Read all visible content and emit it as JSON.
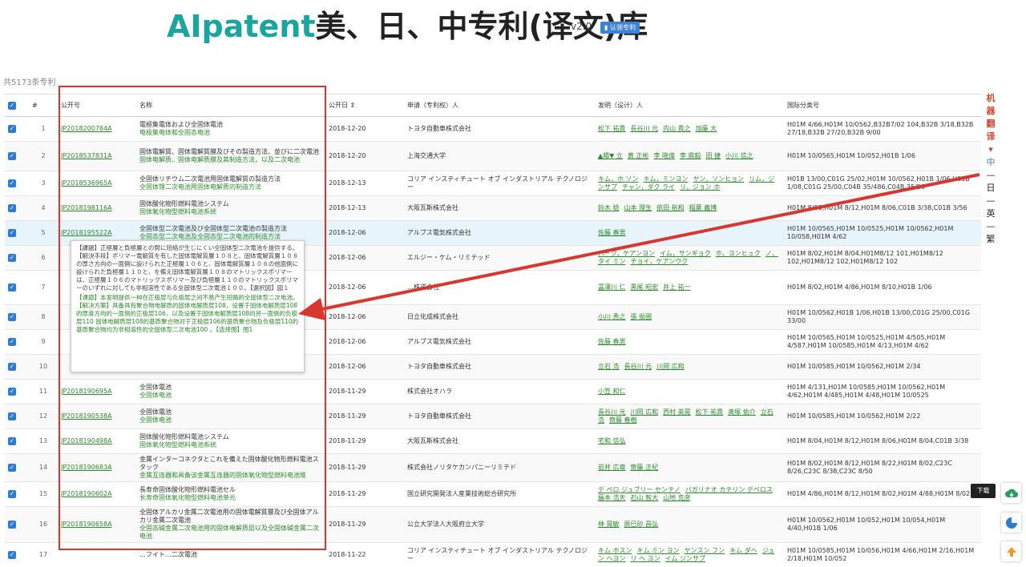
{
  "header": {
    "brand_ai": "AIpatent",
    "brand_rest": "美、日、中专利(译文)库",
    "version": "v2.0",
    "claim_button": "认领专利"
  },
  "total_label": "共5173条专利",
  "columns": [
    "#",
    "公开号",
    "名称",
    "公开日",
    "申请（专利权）人",
    "发明（设计）人",
    "国际分类号"
  ],
  "sort_icon": "sort-icon",
  "rows": [
    {
      "n": "1",
      "pub": "JP2018200784A",
      "title": "電極集電体および全固体電池",
      "title_tr": "电极集电体和全固态电池",
      "date": "2018-12-20",
      "app": "トヨタ自動車株式会社",
      "inv": [
        "松下 祐貴",
        "長谷川 元",
        "内山 貴之",
        "加藤 大"
      ],
      "ipc": "H01M 4/66,H01M 10/0562,B32B7/02 104,B32B 3/18,B32B 27/18,B32B 27/20,B32B 9/00"
    },
    {
      "n": "2",
      "pub": "JP2018537831A",
      "title": "固体電解質、固体電解質膜及びその製造方法、並びに二次電池",
      "title_tr": "固体电解质、固体电解质膜及其制造方法，以及二次电池",
      "date": "2018-12-20",
      "app": "上海交通大学",
      "inv": [
        "▲楊▼ 立",
        "黄 正彬",
        "李 晓偉",
        "李 鼎毅",
        "田 捷",
        "小川 信之"
      ],
      "ipc": "H01M 10/0565,H01M 10/052,H01B 1/06"
    },
    {
      "n": "3",
      "pub": "JP2018536965A",
      "title": "全固体リチウム二次電池用固体電解質の製造方法",
      "title_tr": "全固体锂二次电池用固体电解质的制造方法",
      "date": "2018-12-13",
      "app": "コリア インスティチュート オブ インダストリアル テクノロジー",
      "inv": [
        "キム，ホ ソン",
        "キム，ミンヨン",
        "ヤン，ソンヒョン",
        "リム，ジンサプ",
        "チャン，ダク ライ",
        "リ，ジョン ホ"
      ],
      "ipc": "H01B 13/00,C01G 25/02,H01M 10/0562,H01B 1/06,H01B 1/08,C01G 25/00,C04B 35/486,C04B 35/50"
    },
    {
      "n": "4",
      "pub": "JP2018198116A",
      "title": "固体酸化物形燃料電池システム",
      "title_tr": "固体氧化物型燃料电池系统",
      "date": "2018-12-13",
      "app": "大阪瓦斯株式会社",
      "inv": [
        "鈴木 稔",
        "山本 理生",
        "依田 裕和",
        "稲葉 義博"
      ],
      "ipc": "H01M 8/06,H01M 8/12,H01M 8/06,C01B 3/38,C01B 3/56"
    },
    {
      "n": "5",
      "pub": "JP2018195522A",
      "title": "全固体型二次電池及び全固体型二次電池の製造方法",
      "title_tr": "全固态型二次电池及全固态型二次电池的制造方法",
      "date": "2018-12-06",
      "app": "アルプス電気株式会社",
      "inv": [
        "佐藤 春男"
      ],
      "ipc": "H01M 10/0565,H01M 10/0525,H01M 10/0562,H01M 10/058,H01M 4/62"
    },
    {
      "n": "6",
      "pub": "",
      "title": "",
      "title_tr": "",
      "date": "2018-12-06",
      "app": "エルジー・ケム・リミテッド",
      "inv": [
        "パーク，ケアンヨン",
        "イム，サンギョク",
        "ホ，ヨンヒュク",
        "ノ，タイ ミン",
        "チョイ，ケアンウク"
      ],
      "ipc": "H01M 8/02,H01M 8/04,H01M8/12 101,H01M8/12 102,H01M8/12 102,H01M8/12 102"
    },
    {
      "n": "7",
      "pub": "",
      "title": "",
      "title_tr": "",
      "date": "2018-12-06",
      "app": "…株式会社",
      "inv": [
        "冨澤川 仁",
        "黒尾 昭宏",
        "井上 祐一"
      ],
      "ipc": "H01M 8/02,H01M 4/86,H01M 8/10,H01B 1/06"
    },
    {
      "n": "8",
      "pub": "",
      "title": "",
      "title_tr": "",
      "date": "2018-12-06",
      "app": "日立化成株式会社",
      "inv": [
        "小川 秀之",
        "張 振國"
      ],
      "ipc": "H01M 10/0562,H01B 1/06,H01B 13/00,C01G 25/00,C01G 33/00"
    },
    {
      "n": "9",
      "pub": "",
      "title": "",
      "title_tr": "",
      "date": "2018-12-06",
      "app": "アルプス電気株式会社",
      "inv": [
        "佐藤 春男"
      ],
      "ipc": "H01M 10/0565,H01M 10/0525,H01M 4/505,H01M 4/587,H01M 10/0585,H01M 4/13,H01M 4/62"
    },
    {
      "n": "10",
      "pub": "",
      "title": "",
      "title_tr": "",
      "date": "2018-12-06",
      "app": "トヨタ自動車株式会社",
      "inv": [
        "立石 浩",
        "長谷川 元",
        "川岡 広和"
      ],
      "ipc": "H01M 10/0585,H01M 10/0562,H01M 2/34"
    },
    {
      "n": "11",
      "pub": "JP2018190695A",
      "title": "全固体電池",
      "title_tr": "全固体电池",
      "date": "2018-11-29",
      "app": "株式会社オハラ",
      "inv": [
        "小笠 和仁"
      ],
      "ipc": "H01M 4/131,H01M 10/0585,H01M 10/0562,H01M 4/62,H01M 4/485,H01M 4/48,H01M 10/0525"
    },
    {
      "n": "12",
      "pub": "JP2018190538A",
      "title": "全固体電池",
      "title_tr": "全固体电池",
      "date": "2018-11-29",
      "app": "トヨタ自動車株式会社",
      "inv": [
        "長谷川 元",
        "川岡 広和",
        "西村 英晃",
        "松下 祐貴",
        "奥塚 佑介",
        "立石 浩",
        "齋藤 春樹"
      ],
      "ipc": "H01M 10/0585,H01M 10/0562,H01M 2/22"
    },
    {
      "n": "13",
      "pub": "JP2018190498A",
      "title": "固体酸化物形燃料電池システム",
      "title_tr": "固体氧化物型燃料电池系统",
      "date": "2018-11-29",
      "app": "大阪瓦斯株式会社",
      "inv": [
        "宅和 信弘"
      ],
      "ipc": "H01M 8/04,H01M 8/12,H01M 8/06,H01M 8/04,C01B 3/38"
    },
    {
      "n": "14",
      "pub": "JP2018190683A",
      "title": "金属インターコネクタとこれを備えた固体酸化物形燃料電池スタック",
      "title_tr": "金属互连器和具备该金属互连器的固体氧化物型燃料电池堆",
      "date": "2018-11-29",
      "app": "株式会社ノリタケカンパニーリミテド",
      "inv": [
        "岩井 広章",
        "齋藤 正紀"
      ],
      "ipc": "H01M 8/02,H01M 8/12,H01M 8/22,H01M 8/02,C23C 8/26,C23C 8/38,C23C 8/50"
    },
    {
      "n": "15",
      "pub": "JP2018190602A",
      "title": "長寿命固体酸化物形燃料電池セル",
      "title_tr": "长寿命固体氧化物型燃料电池单元",
      "date": "2018-11-29",
      "app": "国立研究開発法人産業技術総合研究所",
      "inv": [
        "デ ペロ ジュブリー センテノ",
        "パガリナオ カテリン デペロス",
        "藤本 浩天",
        "石山 智大",
        "山地 克彦"
      ],
      "ipc": "H01M 4/86,H01M 8/12,H01M 8/02,H01M 4/88,H01M 8/02"
    },
    {
      "n": "16",
      "pub": "JP2018190658A",
      "title": "全固体アルカリ金属二次電池用の固体電解質層及び全固体アルカリ金属二次電池",
      "title_tr": "全固态碱金属二次电池用的固体电解质层以及全固体碱金属二次电池",
      "date": "2018-11-29",
      "app": "公立大学法人大阪府立大学",
      "inv": [
        "林 晃敏",
        "辰巳砂 昌弘"
      ],
      "ipc": "H01M 10/0562,H01M 10/052,H01M 10/054,H01M 4/40,H01B 1/06"
    },
    {
      "n": "17",
      "pub": "",
      "title": "…フイト…二次電池",
      "title_tr": "",
      "date": "2018-11-22",
      "app": "コリア インスティチュート オブ インダストリアル テクノロジー",
      "inv": [
        "キム ホスン",
        "キム ミン ヨン",
        "ヤンスン フン",
        "キム ダヘ",
        "ジュン ヘヨン",
        "リ ヘ ヨン",
        "イム ジンサプ"
      ],
      "ipc": "H01M 10/0585,H01M 10/056,H01M 4/66,H01M 2/16,H01M 2/18,H01M 10/052"
    }
  ],
  "tooltip": {
    "ja": "【課題】正極層と負極層との間に短絡が生じにくい全固体型二次電池を提供する。【解決手段】ポリマー電解質を有した固体電解質層１０８と、固体電解質層１０８の厚さ方向の一面側に設けられた正極層１０６と、固体電解質層１０８の他面側に設けられた負極層１１０と、を備え固体電解質層１０８のマトリックスポリマーは、正極層１０６のマトリックスポリマー及び負極層１１０のマトリックスポリマーのいずれに対しても非相溶性である全固体型二次電池１００。【選択図】図１",
    "zh": "【课题】本发明提供一种在正极层与负极层之间不易产生短路的全固体型二次电池。【解决方案】具备具有聚合物电解质的固体电解质层108，设置于固体电解质层108的厚度方向的一面侧的正极层106，以及设置于固体电解质层108的另一面侧的负极层110 固体电解质层108的基质聚合物对于正极层106的基质聚合物及负极层110的基质聚合物均为非相溶性的全固体型二次电池100 。【选择图】图1"
  },
  "side_lang": {
    "label": "机器翻译",
    "caret": "▾",
    "options": [
      "中",
      "日",
      "英",
      "繁"
    ]
  },
  "float_buttons": {
    "download_tip": "下载",
    "download_icon": "cloud-download-icon",
    "chart_icon": "pie-chart-icon",
    "top_icon": "arrow-up-icon"
  },
  "colors": {
    "accent": "#1aa5a0",
    "link": "#2a8c2a",
    "annotation": "#d8372f",
    "checkbox": "#2f7bd1"
  }
}
